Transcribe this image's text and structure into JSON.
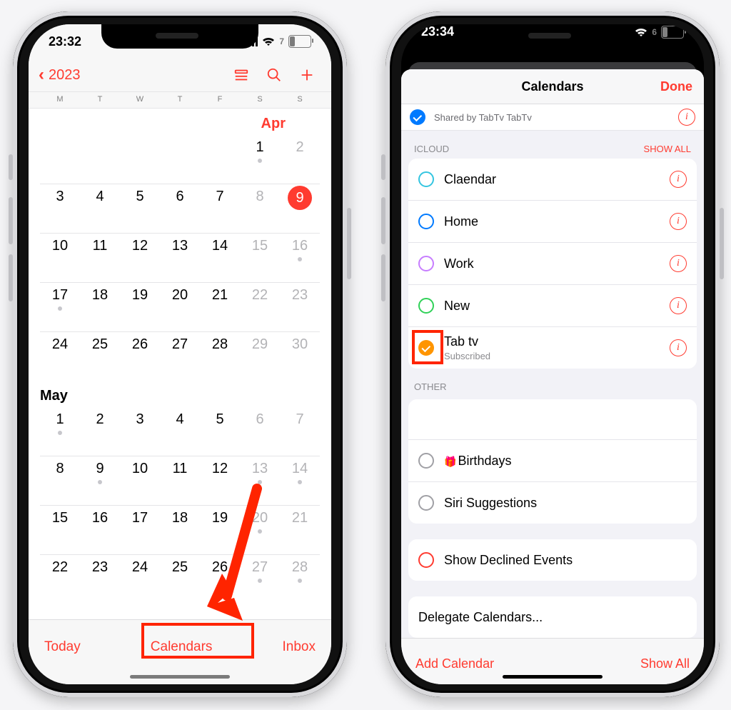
{
  "left": {
    "status": {
      "time": "23:32",
      "battery": "7"
    },
    "topbar": {
      "back_year": "2023"
    },
    "dow": [
      "M",
      "T",
      "W",
      "T",
      "F",
      "S",
      "S"
    ],
    "month_apr": "Apr",
    "month_may": "May",
    "apr_weeks": [
      [
        null,
        null,
        null,
        null,
        null,
        {
          "n": "1",
          "dot": true
        },
        {
          "n": "2",
          "dim": true
        }
      ],
      [
        {
          "n": "3"
        },
        {
          "n": "4"
        },
        {
          "n": "5"
        },
        {
          "n": "6"
        },
        {
          "n": "7"
        },
        {
          "n": "8",
          "dim": true
        },
        {
          "n": "9",
          "today": true
        }
      ],
      [
        {
          "n": "10"
        },
        {
          "n": "11"
        },
        {
          "n": "12"
        },
        {
          "n": "13"
        },
        {
          "n": "14"
        },
        {
          "n": "15",
          "dim": true
        },
        {
          "n": "16",
          "dim": true,
          "dot": true
        }
      ],
      [
        {
          "n": "17",
          "dot": true
        },
        {
          "n": "18"
        },
        {
          "n": "19"
        },
        {
          "n": "20"
        },
        {
          "n": "21"
        },
        {
          "n": "22",
          "dim": true
        },
        {
          "n": "23",
          "dim": true
        }
      ],
      [
        {
          "n": "24"
        },
        {
          "n": "25"
        },
        {
          "n": "26"
        },
        {
          "n": "27"
        },
        {
          "n": "28"
        },
        {
          "n": "29",
          "dim": true
        },
        {
          "n": "30",
          "dim": true
        }
      ]
    ],
    "may_weeks": [
      [
        {
          "n": "1",
          "dot": true
        },
        {
          "n": "2"
        },
        {
          "n": "3"
        },
        {
          "n": "4"
        },
        {
          "n": "5"
        },
        {
          "n": "6",
          "dim": true
        },
        {
          "n": "7",
          "dim": true
        }
      ],
      [
        {
          "n": "8"
        },
        {
          "n": "9",
          "dot": true
        },
        {
          "n": "10"
        },
        {
          "n": "11"
        },
        {
          "n": "12"
        },
        {
          "n": "13",
          "dim": true,
          "dot": true
        },
        {
          "n": "14",
          "dim": true,
          "dot": true
        }
      ],
      [
        {
          "n": "15"
        },
        {
          "n": "16"
        },
        {
          "n": "17"
        },
        {
          "n": "18"
        },
        {
          "n": "19"
        },
        {
          "n": "20",
          "dim": true,
          "dot": true
        },
        {
          "n": "21",
          "dim": true
        }
      ],
      [
        {
          "n": "22"
        },
        {
          "n": "23"
        },
        {
          "n": "24"
        },
        {
          "n": "25"
        },
        {
          "n": "26"
        },
        {
          "n": "27",
          "dim": true,
          "dot": true
        },
        {
          "n": "28",
          "dim": true,
          "dot": true
        }
      ]
    ],
    "footer": {
      "today": "Today",
      "calendars": "Calendars",
      "inbox": "Inbox"
    }
  },
  "right": {
    "status": {
      "time": "23:34",
      "battery": "6"
    },
    "sheet_title": "Calendars",
    "done": "Done",
    "shared_by": "Shared by TabTv TabTv",
    "icloud": {
      "header": "ICLOUD",
      "show_all": "SHOW ALL",
      "items": [
        {
          "label": "Claendar",
          "color": "cyan"
        },
        {
          "label": "Home",
          "color": "blue"
        },
        {
          "label": "Work",
          "color": "purple"
        },
        {
          "label": "New",
          "color": "green"
        },
        {
          "label": "Tab tv",
          "sub": "Subscribed",
          "filled": true
        }
      ]
    },
    "other": {
      "header": "OTHER",
      "items": [
        {
          "label": "Birthdays",
          "gift": true
        },
        {
          "label": "Siri Suggestions"
        }
      ],
      "declined": "Show Declined Events",
      "delegate": "Delegate Calendars..."
    },
    "footer": {
      "add": "Add Calendar",
      "show_all": "Show All"
    }
  }
}
